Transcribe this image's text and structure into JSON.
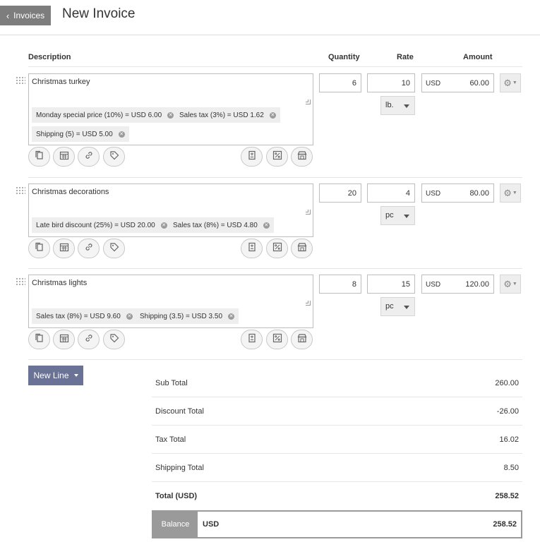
{
  "header": {
    "back_label": "Invoices",
    "title": "New Invoice"
  },
  "columns": {
    "description": "Description",
    "quantity": "Quantity",
    "rate": "Rate",
    "amount": "Amount"
  },
  "lines": [
    {
      "description": "Christmas turkey",
      "quantity": "6",
      "rate": "10",
      "currency": "USD",
      "amount": "60.00",
      "unit": "lb.",
      "tags": [
        "Monday special price (10%) = USD 6.00",
        "Sales tax (3%) = USD 1.62",
        "Shipping (5) = USD 5.00"
      ]
    },
    {
      "description": "Christmas decorations",
      "quantity": "20",
      "rate": "4",
      "currency": "USD",
      "amount": "80.00",
      "unit": "pc",
      "tags": [
        "Late bird discount (25%) = USD 20.00",
        "Sales tax (8%) = USD 4.80"
      ]
    },
    {
      "description": "Christmas lights",
      "quantity": "8",
      "rate": "15",
      "currency": "USD",
      "amount": "120.00",
      "unit": "pc",
      "tags": [
        "Sales tax (8%) = USD 9.60",
        "Shipping (3.5) = USD 3.50"
      ]
    }
  ],
  "new_line_label": "New Line",
  "totals": {
    "sub_total": {
      "label": "Sub Total",
      "value": "260.00"
    },
    "discount_total": {
      "label": "Discount Total",
      "value": "-26.00"
    },
    "tax_total": {
      "label": "Tax Total",
      "value": "16.02"
    },
    "shipping_total": {
      "label": "Shipping Total",
      "value": "8.50"
    },
    "total": {
      "label": "Total (USD)",
      "value": "258.52"
    }
  },
  "balance": {
    "label": "Balance",
    "currency": "USD",
    "value": "258.52"
  },
  "icons": [
    "copy-icon",
    "calendar-icon",
    "link-icon",
    "tag-icon",
    "save-item-icon",
    "percent-icon",
    "inventory-icon",
    "gear-icon",
    "drag-handle-icon"
  ],
  "colors": {
    "back_button": "#7d7d7d",
    "new_line_button": "#6a7396",
    "balance_label": "#9a9a9a"
  }
}
